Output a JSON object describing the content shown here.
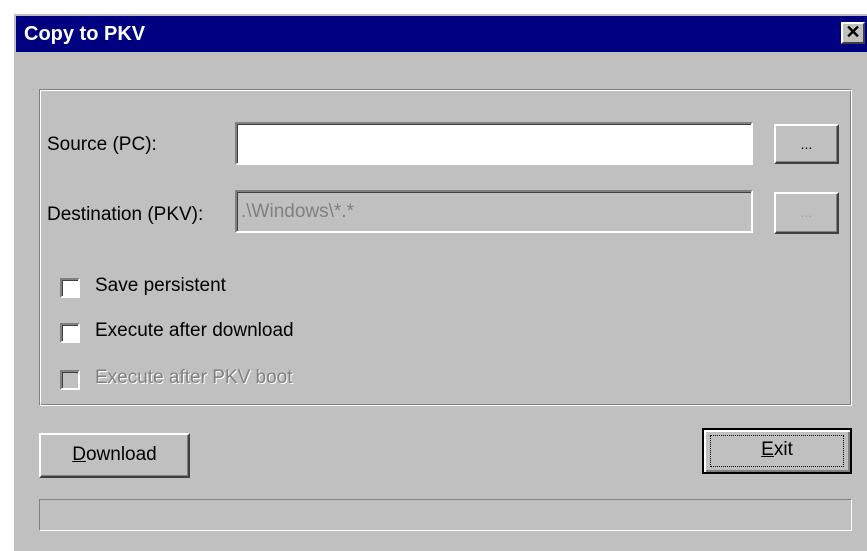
{
  "window": {
    "title": "Copy to PKV",
    "close_glyph": "✕"
  },
  "form": {
    "source_label": "Source (PC):",
    "source_value": "",
    "source_browse_label": "...",
    "destination_label": "Destination (PKV):",
    "destination_value": ".\\Windows\\*.*",
    "destination_browse_label": "..."
  },
  "options": [
    {
      "label": "Save persistent",
      "checked": false,
      "enabled": true
    },
    {
      "label": "Execute after download",
      "checked": false,
      "enabled": true
    },
    {
      "label": "Execute after PKV boot",
      "checked": false,
      "enabled": false
    }
  ],
  "buttons": {
    "download_mnemonic": "D",
    "download_rest": "ownload",
    "exit_mnemonic": "E",
    "exit_rest": "xit"
  },
  "progress": {
    "value": 0
  }
}
